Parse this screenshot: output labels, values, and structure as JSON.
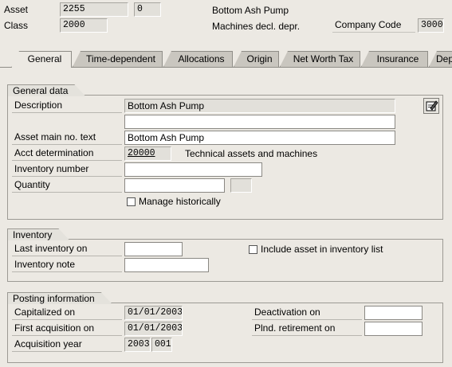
{
  "header": {
    "asset_label": "Asset",
    "asset_value": "2255",
    "sub_number": "0",
    "asset_description": "Bottom Ash Pump",
    "class_label": "Class",
    "class_value": "2000",
    "class_description": "Machines decl. depr.",
    "company_code_label": "Company Code",
    "company_code_value": "3000"
  },
  "tabs": [
    {
      "label": "General",
      "active": true
    },
    {
      "label": "Time-dependent"
    },
    {
      "label": "Allocations"
    },
    {
      "label": "Origin"
    },
    {
      "label": "Net Worth Tax"
    },
    {
      "label": "Insurance"
    },
    {
      "label": "Depr"
    }
  ],
  "general_data": {
    "title": "General data",
    "description_label": "Description",
    "description_value": "Bottom Ash Pump",
    "description_line2": "",
    "main_text_label": "Asset main no. text",
    "main_text_value": "Bottom Ash Pump",
    "acct_label": "Acct determination",
    "acct_value": "20000",
    "acct_description": "Technical assets and machines",
    "inventory_number_label": "Inventory number",
    "inventory_number_value": "",
    "quantity_label": "Quantity",
    "quantity_value": "",
    "unit_value": "",
    "manage_historically_label": "Manage historically",
    "manage_historically_checked": false
  },
  "inventory": {
    "title": "Inventory",
    "last_inventory_label": "Last inventory on",
    "last_inventory_value": "",
    "inventory_note_label": "Inventory note",
    "inventory_note_value": "",
    "include_label": "Include asset in inventory list",
    "include_checked": false
  },
  "posting": {
    "title": "Posting information",
    "capitalized_label": "Capitalized on",
    "capitalized_value": "01/01/2003",
    "first_acq_label": "First acquisition on",
    "first_acq_value": "01/01/2003",
    "acq_year_label": "Acquisition year",
    "acq_year_value": "2003",
    "acq_period_value": "001",
    "deactivation_label": "Deactivation on",
    "deactivation_value": "",
    "retirement_label": "Plnd. retirement on",
    "retirement_value": ""
  },
  "icons": {
    "edit_long_text": "pencil-notepad-icon"
  }
}
